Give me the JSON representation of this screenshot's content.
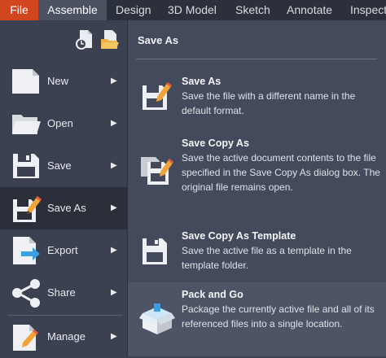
{
  "ribbon": {
    "tabs": [
      "File",
      "Assemble",
      "Design",
      "3D Model",
      "Sketch",
      "Annotate",
      "Inspect"
    ],
    "active_tab": "Assemble"
  },
  "quick_access": [
    "recent-documents-icon",
    "open-folder-icon"
  ],
  "menu": {
    "items": [
      {
        "label": "New",
        "icon": "new-document-icon",
        "arrow": "▶"
      },
      {
        "label": "Open",
        "icon": "folder-open-icon",
        "arrow": "▶"
      },
      {
        "label": "Save",
        "icon": "floppy-disk-icon",
        "arrow": "▶"
      },
      {
        "label": "Save As",
        "icon": "floppy-pencil-icon",
        "arrow": "▶",
        "selected": true
      },
      {
        "label": "Export",
        "icon": "export-arrow-icon",
        "arrow": "▶"
      },
      {
        "label": "Share",
        "icon": "share-icon",
        "arrow": "▶"
      },
      {
        "label": "Manage",
        "icon": "manage-pencil-icon",
        "arrow": "▶"
      }
    ]
  },
  "submenu": {
    "title": "Save As",
    "entries": [
      {
        "title": "Save As",
        "description": "Save the file with a different name in the default format.",
        "icon": "save-as-icon"
      },
      {
        "title": "Save Copy As",
        "description": "Save the active document contents to the file specified in the Save Copy As dialog box. The original file remains open.",
        "icon": "save-copy-as-icon"
      },
      {
        "title": "Save Copy As Template",
        "description": "Save the active file as a template in the template folder.",
        "icon": "save-template-icon"
      },
      {
        "title": "Pack and Go",
        "description": "Package the currently active file and all of its referenced files into a single location.",
        "icon": "pack-and-go-icon",
        "hover": true
      }
    ]
  },
  "colors": {
    "file_tab": "#d2461f",
    "menu_bg": "#3b4150",
    "panel_bg": "#434a5b",
    "selected_item_bg": "#2a2f39",
    "accent_blue": "#3aa0e6"
  }
}
